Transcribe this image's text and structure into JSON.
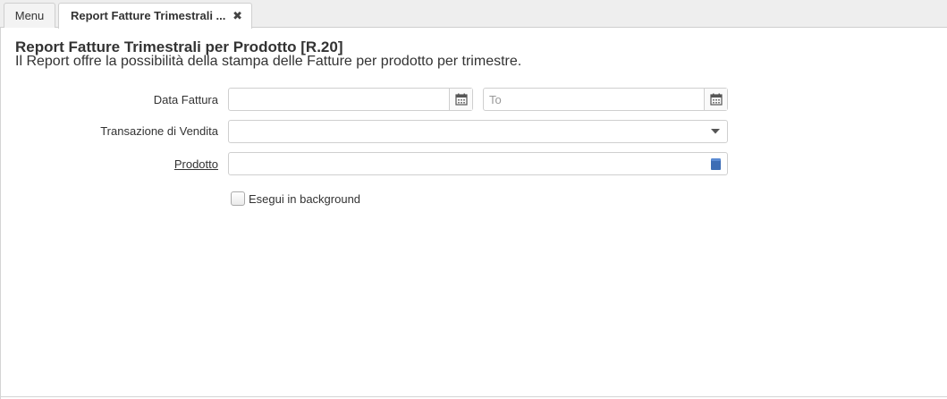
{
  "tabs": {
    "menu_label": "Menu",
    "active_label": "Report Fatture Trimestrali ...",
    "close_glyph": "✖"
  },
  "header": {
    "title": "Report Fatture Trimestrali per Prodotto [R.20]",
    "description": "Il Report offre la possibilità della stampa delle Fatture per prodotto per trimestre."
  },
  "form": {
    "data_fattura": {
      "label": "Data Fattura",
      "from_value": "",
      "to_value": "",
      "to_placeholder": "To",
      "icon": "calendar-icon"
    },
    "transazione": {
      "label": "Transazione di Vendita",
      "value": "",
      "icon": "chevron-down-icon"
    },
    "prodotto": {
      "label": "Prodotto",
      "value": "",
      "icon": "product-search-icon"
    },
    "background": {
      "label": "Esegui in background",
      "checked": false
    }
  }
}
